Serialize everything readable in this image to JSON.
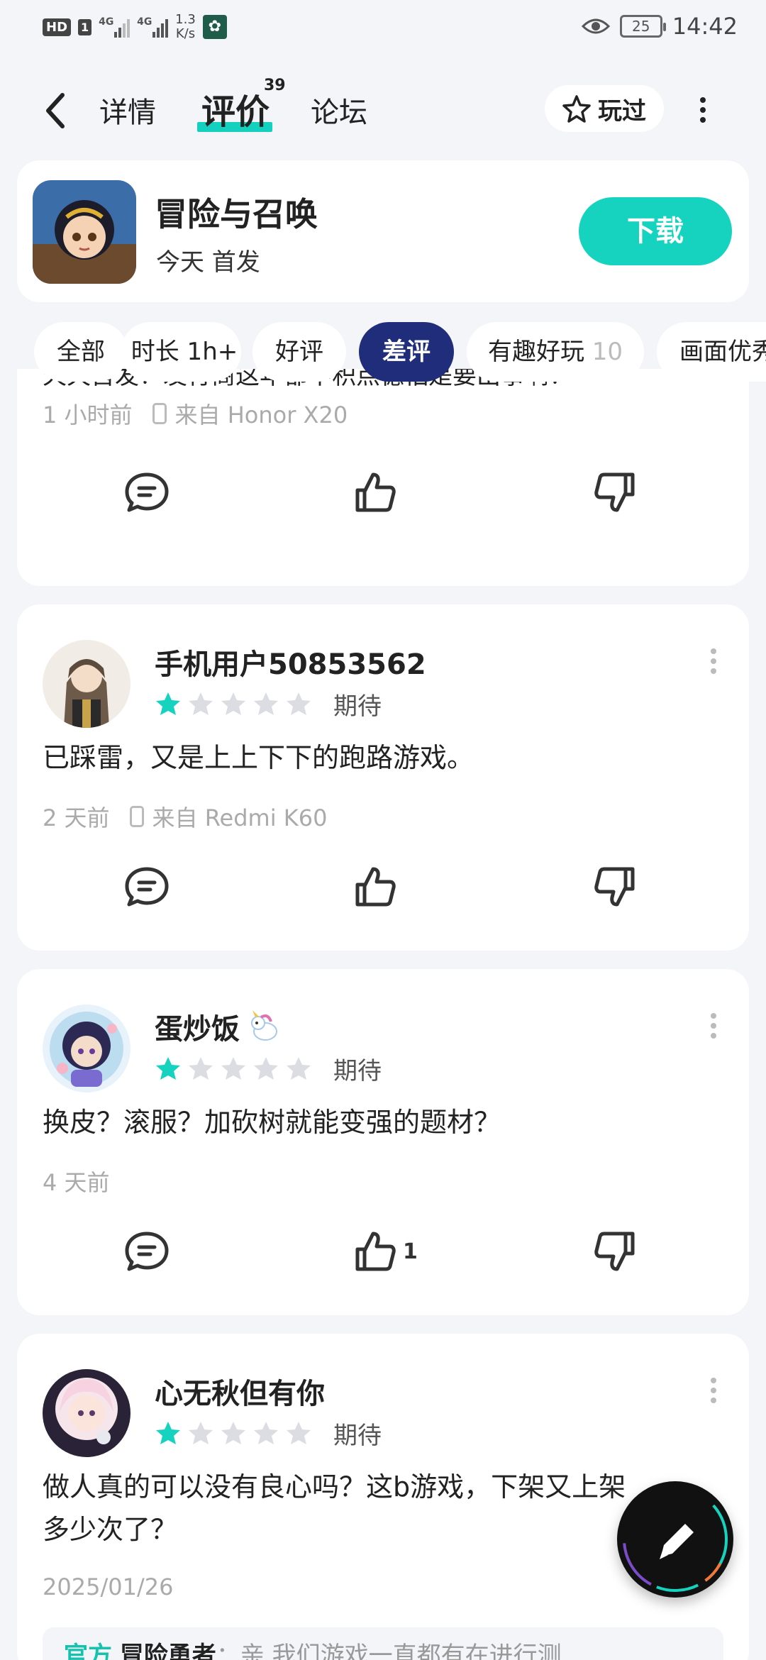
{
  "status_bar": {
    "hd": "HD",
    "sim": "1",
    "signal_1": "4G",
    "signal_2": "4G",
    "net_speed_value": "1.3",
    "net_speed_unit": "K/s",
    "battery": "25",
    "time": "14:42"
  },
  "nav": {
    "tab_detail": "详情",
    "tab_review": "评价",
    "review_count": "39",
    "tab_forum": "论坛",
    "played_label": "玩过"
  },
  "game": {
    "title": "冒险与召唤",
    "subtitle": "今天 首发",
    "download_label": "下载"
  },
  "filters": [
    {
      "label": "全部"
    },
    {
      "label": "时长 1h+"
    },
    {
      "label": "好评"
    },
    {
      "label": "差评"
    },
    {
      "label": "有趣好玩",
      "count": "10"
    },
    {
      "label": "画面优秀"
    }
  ],
  "accent_color": "#15d3bf",
  "active_chip_color": "#1f2d7a",
  "clipped_review": {
    "text": "天天首发！发行商这年都不积点德怕是要出事啊！",
    "time": "1 小时前",
    "device": "来自 Honor X20"
  },
  "reviews": [
    {
      "user": "手机用户50853562",
      "stars": 1,
      "rating_label": "期待",
      "text": "已踩雷，又是上上下下的跑路游戏。",
      "time": "2 天前",
      "device": "来自 Redmi K60",
      "likes": ""
    },
    {
      "user": "蛋炒饭",
      "stars": 1,
      "rating_label": "期待",
      "text": "换皮？滚服？加砍树就能变强的题材？",
      "time": "4 天前",
      "device": "",
      "likes": "1"
    },
    {
      "user": "心无秋但有你",
      "stars": 1,
      "rating_label": "期待",
      "text_line1": "做人真的可以没有良心吗？这b游戏，下架又上架",
      "text_line2": "多少次了？",
      "time": "2025/01/26",
      "reply_badge": "官方",
      "reply_author": "冒险勇者",
      "reply_text": "：亲 我们游戏一直都有在进行测"
    }
  ]
}
